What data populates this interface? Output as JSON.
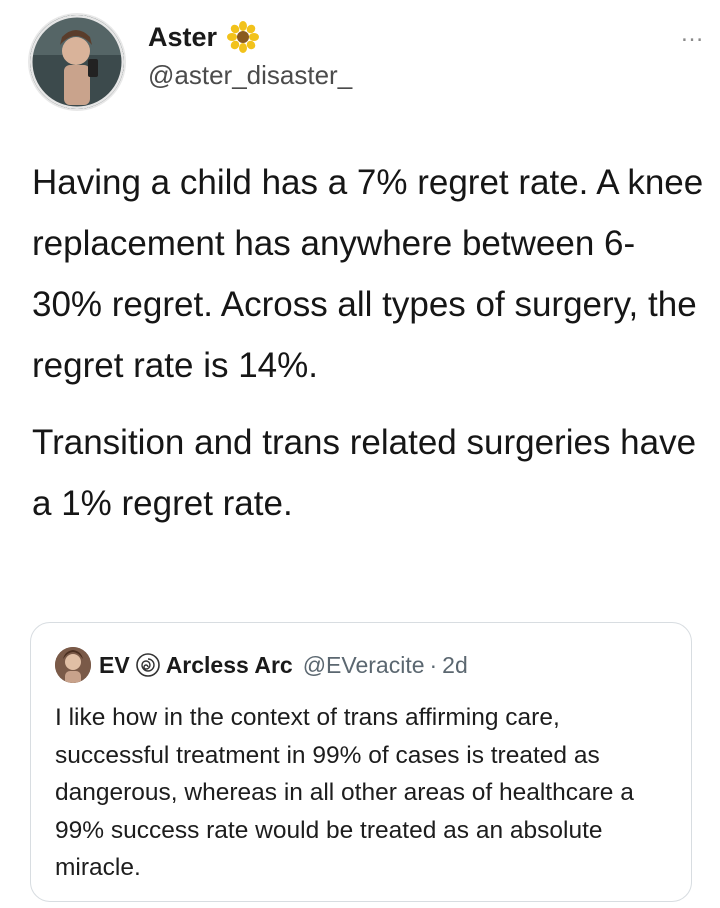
{
  "tweet": {
    "display_name": "Aster",
    "name_emoji_icon": "sunflower-icon",
    "handle": "@aster_disaster_",
    "more_label": "…",
    "paragraphs": [
      "Having a child has a 7% regret rate. A knee replacement has anywhere between 6-30% regret. Across all types of surgery, the regret rate is 14%.",
      "Transition and trans related surgeries have a 1% regret rate."
    ]
  },
  "quoted_tweet": {
    "name_part1": "EV",
    "badge_icon": "spiral-badge-icon",
    "name_part2": "Arcless Arc",
    "handle": "@EVeracite",
    "separator": "·",
    "time": "2d",
    "text": "I like how in the context of trans affirming care, successful treatment in 99% of cases is treated as dangerous, whereas in all other areas of healthcare a 99% success rate would be treated as an absolute miracle."
  },
  "colors": {
    "text": "#161616",
    "secondary": "#5b6770",
    "border": "#d8dde1",
    "flower": "#f2c21b"
  }
}
